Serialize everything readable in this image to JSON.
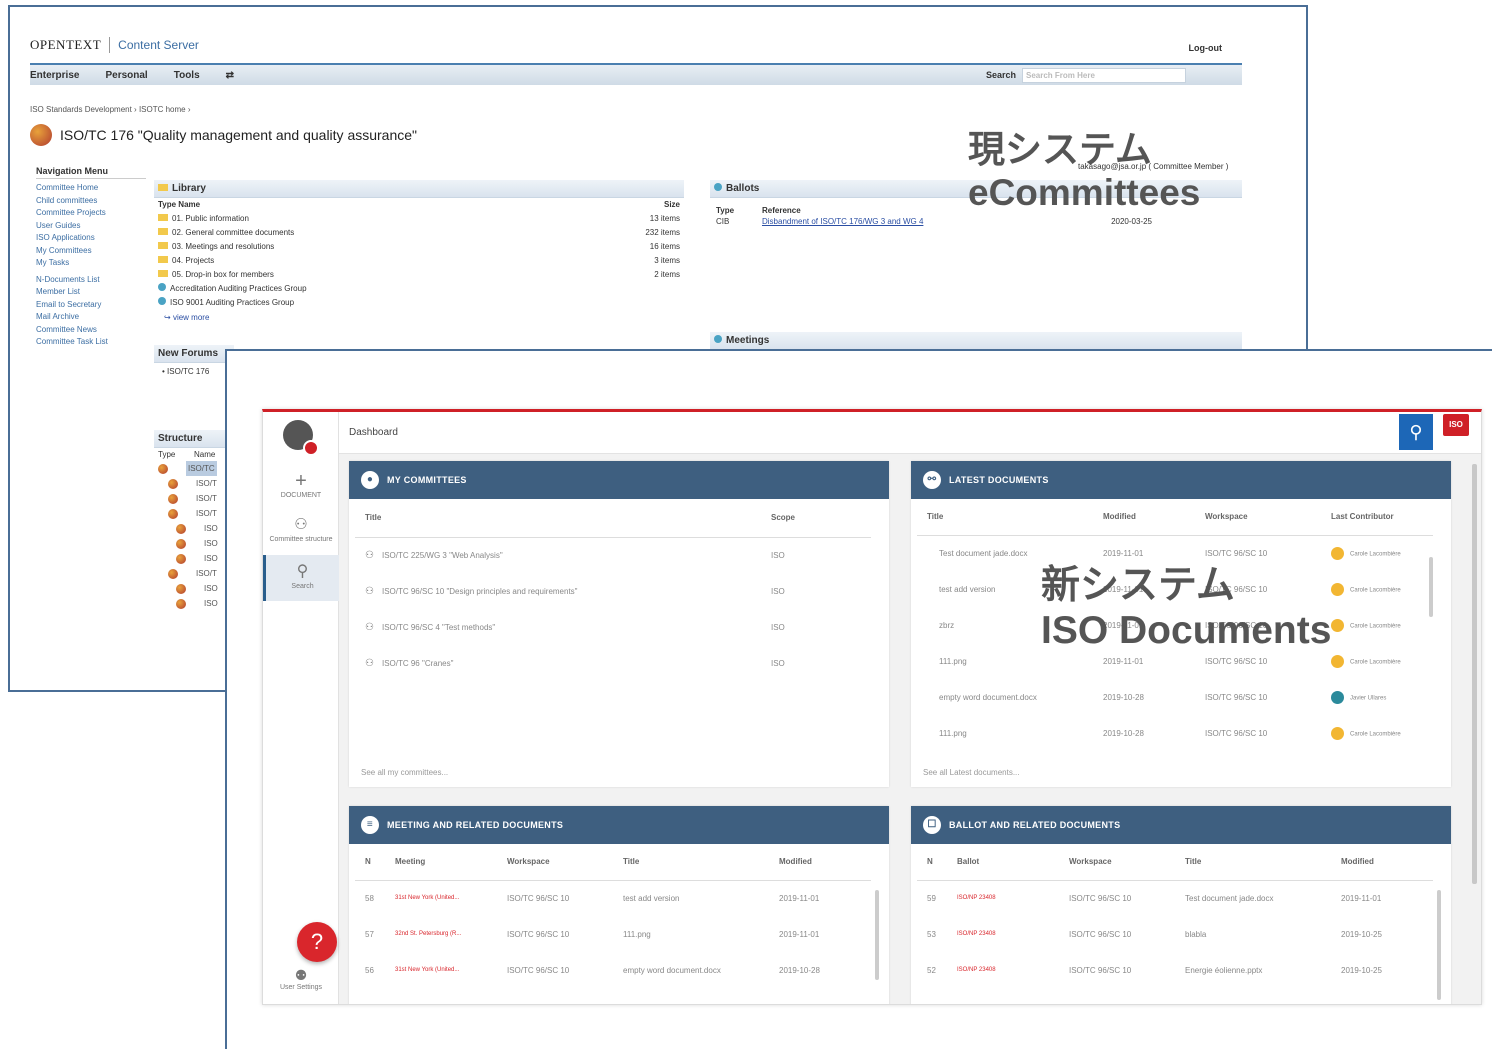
{
  "old_system": {
    "brand": "OPENTEXT",
    "product": "Content Server",
    "logout": "Log-out",
    "menu": [
      "Enterprise",
      "Personal",
      "Tools",
      "⇄"
    ],
    "search_label": "Search",
    "search_placeholder": "Search From Here",
    "breadcrumb": "ISO Standards Development ›  ISOTC home ›",
    "title": "ISO/TC 176 \"Quality management and quality assurance\"",
    "user_line": "takasago@jsa.or.jp ( Committee Member )",
    "nav": {
      "heading": "Navigation Menu",
      "items": [
        "Committee Home",
        "Child committees",
        "Committee Projects",
        "User Guides",
        "ISO Applications",
        "My Committees",
        "My Tasks",
        "N-Documents List",
        "Member List",
        "Email to Secretary",
        "Mail Archive",
        "Committee News",
        "Committee Task List"
      ]
    },
    "library": {
      "heading": "Library",
      "col_type_name": "Type  Name",
      "col_size": "Size",
      "rows": [
        {
          "name": "01. Public information",
          "size": "13 items",
          "icon": "folder"
        },
        {
          "name": "02. General committee documents",
          "size": "232 items",
          "icon": "folder"
        },
        {
          "name": "03. Meetings and resolutions",
          "size": "16 items",
          "icon": "folder"
        },
        {
          "name": "04. Projects",
          "size": "3 items",
          "icon": "folder"
        },
        {
          "name": "05. Drop-in box for members",
          "size": "2 items",
          "icon": "folder"
        },
        {
          "name": "Accreditation Auditing Practices Group",
          "size": "",
          "icon": "globe"
        },
        {
          "name": "ISO 9001 Auditing Practices Group",
          "size": "",
          "icon": "globe"
        }
      ],
      "view_more": "view more"
    },
    "ballots": {
      "heading": "Ballots",
      "col_type": "Type",
      "col_reference": "Reference",
      "row_type": "CIB",
      "row_reference": "Disbandment of ISO/TC 176/WG 3 and WG 4",
      "row_date": "2020-03-25"
    },
    "forums_heading": "New Forums",
    "forums_item": "ISO/TC 176",
    "meetings_heading": "Meetings",
    "structure": {
      "heading": "Structure",
      "col_type": "Type",
      "col_name": "Name",
      "items": [
        "ISO/TC",
        "ISO/T",
        "ISO/T",
        "ISO/T",
        "ISO",
        "ISO",
        "ISO",
        "ISO/T",
        "ISO",
        "ISO"
      ]
    },
    "label_line1": "現システム",
    "label_line2": "eCommittees"
  },
  "new_system": {
    "breadcrumb": "Dashboard",
    "sidebar": [
      {
        "label": "DOCUMENT",
        "icon": "plus-icon"
      },
      {
        "label": "Committee structure",
        "icon": "structure-icon"
      },
      {
        "label": "Search",
        "icon": "search-icon"
      }
    ],
    "help": "?",
    "user_settings": "User Settings",
    "iso_logo": "ISO",
    "my_committees": {
      "title": "MY COMMITTEES",
      "columns": [
        "Title",
        "Scope"
      ],
      "rows": [
        {
          "title": "ISO/TC 225/WG 3 \"Web Analysis\"",
          "scope": "ISO"
        },
        {
          "title": "ISO/TC 96/SC 10 \"Design principles and requirements\"",
          "scope": "ISO"
        },
        {
          "title": "ISO/TC 96/SC 4 \"Test methods\"",
          "scope": "ISO"
        },
        {
          "title": "ISO/TC 96 \"Cranes\"",
          "scope": "ISO"
        }
      ],
      "footer": "See all my committees..."
    },
    "latest_documents": {
      "title": "LATEST DOCUMENTS",
      "columns": [
        "Title",
        "Modified",
        "Workspace",
        "Last Contributor"
      ],
      "rows": [
        {
          "title": "Test document jade.docx",
          "modified": "2019-11-01",
          "workspace": "ISO/TC 96/SC 10",
          "contributor": "Carole Lacombière",
          "color": "#f2b632"
        },
        {
          "title": "test add version",
          "modified": "2019-11-01",
          "workspace": "ISO/TC 96/SC 10",
          "contributor": "Carole Lacombière",
          "color": "#f2b632"
        },
        {
          "title": "zbrz",
          "modified": "2019-11-01",
          "workspace": "ISO/TC 96/SC 10",
          "contributor": "Carole Lacombière",
          "color": "#f2b632"
        },
        {
          "title": "111.png",
          "modified": "2019-11-01",
          "workspace": "ISO/TC 96/SC 10",
          "contributor": "Carole Lacombière",
          "color": "#f2b632"
        },
        {
          "title": "empty word document.docx",
          "modified": "2019-10-28",
          "workspace": "ISO/TC 96/SC 10",
          "contributor": "Javier Ullares",
          "color": "#2b8a9b"
        },
        {
          "title": "111.png",
          "modified": "2019-10-28",
          "workspace": "ISO/TC 96/SC 10",
          "contributor": "Carole Lacombière",
          "color": "#f2b632"
        }
      ],
      "footer": "See all Latest documents..."
    },
    "meeting_docs": {
      "title": "MEETING AND RELATED DOCUMENTS",
      "columns": [
        "N",
        "Meeting",
        "Workspace",
        "Title",
        "Modified"
      ],
      "rows": [
        {
          "n": "58",
          "meeting": "31st New York (United...",
          "workspace": "ISO/TC 96/SC 10",
          "title": "test add version",
          "modified": "2019-11-01"
        },
        {
          "n": "57",
          "meeting": "32nd St. Petersburg (R...",
          "workspace": "ISO/TC 96/SC 10",
          "title": "111.png",
          "modified": "2019-11-01"
        },
        {
          "n": "56",
          "meeting": "31st New York (United...",
          "workspace": "ISO/TC 96/SC 10",
          "title": "empty word document.docx",
          "modified": "2019-10-28"
        }
      ]
    },
    "ballot_docs": {
      "title": "BALLOT AND RELATED DOCUMENTS",
      "columns": [
        "N",
        "Ballot",
        "Workspace",
        "Title",
        "Modified"
      ],
      "rows": [
        {
          "n": "59",
          "ballot": "ISO/NP 23408",
          "workspace": "ISO/TC 96/SC 10",
          "title": "Test document jade.docx",
          "modified": "2019-11-01"
        },
        {
          "n": "53",
          "ballot": "ISO/NP 23408",
          "workspace": "ISO/TC 96/SC 10",
          "title": "blabla",
          "modified": "2019-10-25"
        },
        {
          "n": "52",
          "ballot": "ISO/NP 23408",
          "workspace": "ISO/TC 96/SC 10",
          "title": "Energie éolienne.pptx",
          "modified": "2019-10-25"
        }
      ]
    },
    "label_line1": "新システム",
    "label_line2": "ISO  Documents"
  }
}
